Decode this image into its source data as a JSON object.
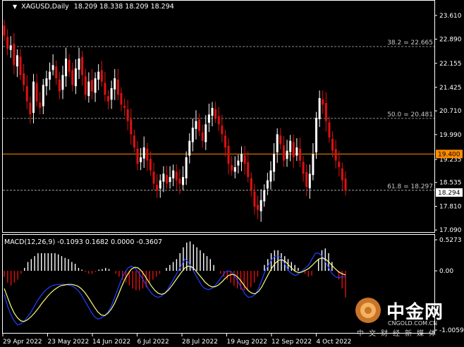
{
  "window": {
    "symbol_title": "XAGUSD,Daily",
    "ohlc": "18.209 18.338 18.209 18.294",
    "macd_title": "MACD(12,26,9) -0.1093 0.1682 0.0000 -0.3607"
  },
  "colors": {
    "background": "#000000",
    "bull_candle": "#ffffff",
    "bear_candle": "#e01010",
    "hline": "#ff8c00",
    "macd_signal": "#ffff80",
    "macd_main": "#2040ff",
    "price_tag_bg": "#ffffff"
  },
  "watermark": {
    "name": "中金网",
    "url": "CNGOLD.COM.CN",
    "tagline": "中文财经新媒体"
  },
  "chart_data": {
    "type": "candlestick",
    "title": "XAGUSD,Daily",
    "price_axis": {
      "range": [
        17.05,
        23.95
      ],
      "ticks": [
        "23.610",
        "22.890",
        "22.155",
        "21.425",
        "20.710",
        "19.990",
        "19.235",
        "18.535",
        "17.810",
        "17.090"
      ]
    },
    "time_axis": {
      "ticks": [
        "29 Apr 2022",
        "23 May 2022",
        "14 Jun 2022",
        "6 Jul 2022",
        "28 Jul 2022",
        "19 Aug 2022",
        "12 Sep 2022",
        "4 Oct 2022"
      ]
    },
    "fib_levels": [
      {
        "label": "38.2 = 22.665",
        "value": 22.665
      },
      {
        "label": "50.0 = 20.481",
        "value": 20.481
      },
      {
        "label": "61.8 = 18.297",
        "value": 18.297
      }
    ],
    "horizontal_line": {
      "label": "19.400",
      "value": 19.4
    },
    "current_price": {
      "label": "18.294",
      "value": 18.294
    },
    "close_series": [
      23.0,
      22.6,
      22.7,
      22.1,
      22.4,
      21.8,
      21.5,
      21.0,
      20.6,
      21.6,
      21.0,
      20.8,
      21.5,
      21.7,
      21.9,
      22.1,
      21.7,
      21.3,
      21.8,
      22.3,
      21.9,
      21.5,
      22.0,
      22.3,
      21.8,
      21.2,
      21.6,
      21.3,
      21.7,
      21.9,
      21.6,
      21.2,
      21.0,
      21.4,
      21.7,
      21.2,
      20.9,
      20.8,
      20.4,
      20.0,
      19.6,
      19.1,
      19.3,
      19.6,
      19.2,
      18.9,
      18.5,
      18.3,
      18.6,
      18.8,
      18.5,
      18.7,
      18.9,
      18.6,
      18.5,
      18.7,
      19.3,
      19.8,
      20.2,
      20.4,
      20.1,
      19.8,
      20.3,
      20.6,
      20.8,
      20.5,
      20.3,
      20.0,
      19.6,
      19.1,
      18.9,
      19.0,
      19.2,
      19.4,
      19.1,
      18.7,
      18.3,
      17.8,
      17.7,
      18.0,
      18.3,
      18.6,
      18.9,
      19.4,
      20.0,
      19.7,
      19.2,
      19.5,
      19.8,
      19.3,
      19.6,
      19.2,
      18.8,
      18.4,
      18.8,
      19.4,
      20.5,
      21.1,
      20.9,
      20.4,
      19.9,
      19.5,
      19.2,
      19.0,
      18.6,
      18.294
    ],
    "macd": {
      "axis_ticks": [
        "0.5273",
        "0.00",
        "-1.0059"
      ],
      "axis_range": [
        -1.0059,
        0.5273
      ],
      "histogram": [
        -0.1,
        -0.2,
        -0.25,
        -0.2,
        -0.15,
        -0.05,
        0.05,
        0.15,
        0.2,
        0.25,
        0.3,
        0.3,
        0.3,
        0.3,
        0.3,
        0.3,
        0.28,
        0.25,
        0.22,
        0.2,
        0.15,
        0.12,
        0.05,
        0.02,
        -0.02,
        -0.05,
        -0.05,
        -0.02,
        0.02,
        0.03,
        0.05,
        0.03,
        0.0,
        -0.05,
        -0.1,
        -0.15,
        -0.2,
        -0.25,
        -0.3,
        -0.33,
        -0.33,
        -0.3,
        -0.28,
        -0.2,
        -0.15,
        -0.1,
        -0.05,
        0.0,
        0.05,
        0.1,
        0.15,
        0.2,
        0.3,
        0.4,
        0.48,
        0.5,
        0.45,
        0.4,
        0.35,
        0.3,
        0.25,
        0.2,
        0.1,
        0.0,
        -0.05,
        -0.1,
        -0.15,
        -0.2,
        -0.25,
        -0.3,
        -0.32,
        -0.33,
        -0.32,
        -0.28,
        -0.2,
        -0.1,
        0.0,
        0.1,
        0.2,
        0.3,
        0.35,
        0.35,
        0.3,
        0.25,
        0.2,
        0.15,
        0.1,
        0.05,
        0.0,
        -0.05,
        -0.1,
        -0.08,
        0.0,
        0.2,
        0.35,
        0.38,
        0.3,
        0.15,
        0.0,
        -0.15,
        -0.3,
        -0.45
      ],
      "main": [
        -0.4,
        -0.6,
        -0.75,
        -0.85,
        -0.92,
        -0.9,
        -0.85,
        -0.78,
        -0.7,
        -0.6,
        -0.5,
        -0.42,
        -0.35,
        -0.3,
        -0.26,
        -0.24,
        -0.23,
        -0.23,
        -0.23,
        -0.24,
        -0.25,
        -0.28,
        -0.33,
        -0.4,
        -0.5,
        -0.6,
        -0.7,
        -0.78,
        -0.82,
        -0.8,
        -0.76,
        -0.7,
        -0.6,
        -0.45,
        -0.3,
        -0.15,
        -0.03,
        0.05,
        0.08,
        0.05,
        -0.02,
        -0.1,
        -0.2,
        -0.3,
        -0.38,
        -0.43,
        -0.45,
        -0.43,
        -0.38,
        -0.3,
        -0.2,
        -0.1,
        0.0,
        0.1,
        0.2,
        0.15,
        0.05,
        -0.05,
        -0.15,
        -0.25,
        -0.3,
        -0.32,
        -0.3,
        -0.25,
        -0.18,
        -0.1,
        -0.02,
        0.0,
        -0.02,
        -0.1,
        -0.2,
        -0.3,
        -0.4,
        -0.45,
        -0.44,
        -0.4,
        -0.3,
        -0.15,
        0.0,
        0.1,
        0.2,
        0.25,
        0.25,
        0.2,
        0.1,
        0.0,
        -0.05,
        -0.08,
        -0.05,
        0.0,
        0.05,
        0.1,
        0.2,
        0.3,
        0.3,
        0.25,
        0.15,
        0.05,
        -0.05,
        -0.1,
        -0.12,
        -0.1,
        -0.11
      ],
      "signal": [
        -0.3,
        -0.45,
        -0.6,
        -0.72,
        -0.8,
        -0.85,
        -0.86,
        -0.83,
        -0.78,
        -0.72,
        -0.65,
        -0.57,
        -0.5,
        -0.43,
        -0.37,
        -0.32,
        -0.28,
        -0.25,
        -0.24,
        -0.23,
        -0.23,
        -0.24,
        -0.26,
        -0.3,
        -0.36,
        -0.44,
        -0.53,
        -0.62,
        -0.7,
        -0.75,
        -0.76,
        -0.72,
        -0.65,
        -0.55,
        -0.42,
        -0.28,
        -0.15,
        -0.05,
        0.03,
        0.06,
        0.05,
        0.0,
        -0.08,
        -0.17,
        -0.26,
        -0.33,
        -0.38,
        -0.4,
        -0.38,
        -0.33,
        -0.26,
        -0.18,
        -0.1,
        -0.02,
        0.05,
        0.08,
        0.07,
        0.02,
        -0.05,
        -0.12,
        -0.19,
        -0.24,
        -0.27,
        -0.27,
        -0.24,
        -0.19,
        -0.13,
        -0.08,
        -0.06,
        -0.07,
        -0.12,
        -0.19,
        -0.27,
        -0.34,
        -0.38,
        -0.39,
        -0.35,
        -0.27,
        -0.16,
        -0.05,
        0.05,
        0.13,
        0.18,
        0.19,
        0.16,
        0.1,
        0.04,
        -0.01,
        -0.03,
        -0.02,
        0.01,
        0.04,
        0.09,
        0.15,
        0.2,
        0.22,
        0.2,
        0.15,
        0.09,
        0.03,
        -0.02,
        -0.05,
        -0.07
      ]
    }
  }
}
